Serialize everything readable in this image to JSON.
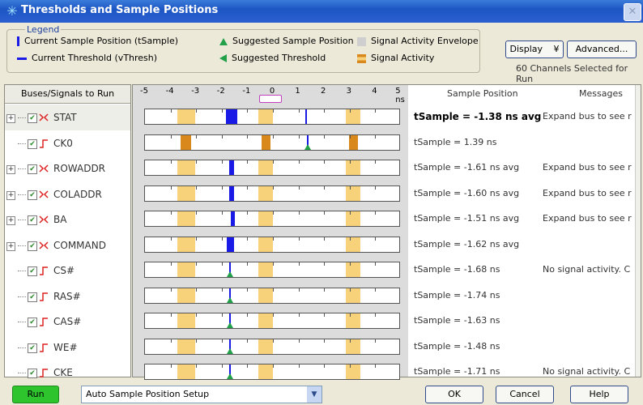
{
  "window": {
    "title": "Thresholds and Sample Positions"
  },
  "legend": {
    "title": "Legend",
    "items": [
      {
        "label": "Current Sample Position (tSample)",
        "icon": "blue-bar-icon"
      },
      {
        "label": "Current Threshold (vThresh)",
        "icon": "blue-line-icon"
      },
      {
        "label": "Suggested Sample Position",
        "icon": "green-up-triangle-icon"
      },
      {
        "label": "Suggested Threshold",
        "icon": "green-left-triangle-icon"
      },
      {
        "label": "Signal Activity Envelope",
        "icon": "gray-square-icon"
      },
      {
        "label": "Signal Activity",
        "icon": "hourglass-icon"
      }
    ]
  },
  "controls": {
    "display_label": "Display",
    "display_arrow": "¥",
    "advanced_label": "Advanced...",
    "channels_text": "60 Channels Selected for Run"
  },
  "signals_header": "Buses/Signals to Run",
  "axis": {
    "ticks": [
      "-5",
      "-4",
      "-3",
      "-2",
      "-1",
      "0",
      "1",
      "2",
      "3",
      "4",
      "5 ns"
    ]
  },
  "columns": {
    "sample_position": "Sample Position",
    "messages": "Messages"
  },
  "signals": [
    {
      "name": "STAT",
      "bus": true,
      "sample": "tSample = -1.38 ns avg",
      "bold": true,
      "message": "Expand bus to see r"
    },
    {
      "name": "CK0",
      "bus": false,
      "sample": "tSample = 1.39 ns",
      "bold": false,
      "message": ""
    },
    {
      "name": "ROWADDR",
      "bus": true,
      "sample": "tSample = -1.61 ns avg",
      "bold": false,
      "message": "Expand bus to see r"
    },
    {
      "name": "COLADDR",
      "bus": true,
      "sample": "tSample = -1.60 ns avg",
      "bold": false,
      "message": "Expand bus to see r"
    },
    {
      "name": "BA",
      "bus": true,
      "sample": "tSample = -1.51 ns avg",
      "bold": false,
      "message": "Expand bus to see r"
    },
    {
      "name": "COMMAND",
      "bus": true,
      "sample": "tSample = -1.62 ns avg",
      "bold": false,
      "message": ""
    },
    {
      "name": "CS#",
      "bus": false,
      "sample": "tSample = -1.68 ns",
      "bold": false,
      "message": "No signal activity. C"
    },
    {
      "name": "RAS#",
      "bus": false,
      "sample": "tSample = -1.74 ns",
      "bold": false,
      "message": ""
    },
    {
      "name": "CAS#",
      "bus": false,
      "sample": "tSample = -1.63 ns",
      "bold": false,
      "message": ""
    },
    {
      "name": "WE#",
      "bus": false,
      "sample": "tSample = -1.48 ns",
      "bold": false,
      "message": ""
    },
    {
      "name": "CKE",
      "bus": false,
      "sample": "tSample = -1.71 ns",
      "bold": false,
      "message": "No signal activity. C"
    }
  ],
  "bottom": {
    "run_label": "Run",
    "setup_value": "Auto Sample Position Setup",
    "ok_label": "OK",
    "cancel_label": "Cancel",
    "help_label": "Help"
  },
  "colors": {
    "accent": "#1a1ae6",
    "envelope": "#f8d27a",
    "activity": "#d9891c",
    "run_button": "#2ec42e"
  }
}
